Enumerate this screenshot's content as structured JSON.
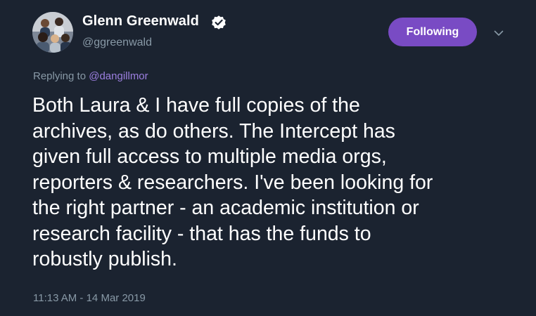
{
  "author": {
    "display_name": "Glenn Greenwald",
    "handle": "@ggreenwald",
    "verified": true,
    "avatar_icon": "group-photo-avatar"
  },
  "actions": {
    "follow_label": "Following",
    "menu_icon": "chevron-down-icon"
  },
  "reply": {
    "prefix": "Replying to",
    "mention": "@dangillmor"
  },
  "tweet": {
    "lines": [
      "Both Laura & I have full copies of the",
      "archives, as do others. The Intercept has",
      "given full access to multiple media orgs,",
      "reporters & researchers. I've been looking for",
      "the right partner - an academic institution or",
      "research facility - that has the funds to",
      "robustly publish."
    ],
    "timestamp": "11:13 AM - 14 Mar 2019"
  },
  "colors": {
    "background": "#1b2330",
    "accent": "#794bc4",
    "mention": "#9c7fe0",
    "secondary_text": "#8899a6"
  }
}
